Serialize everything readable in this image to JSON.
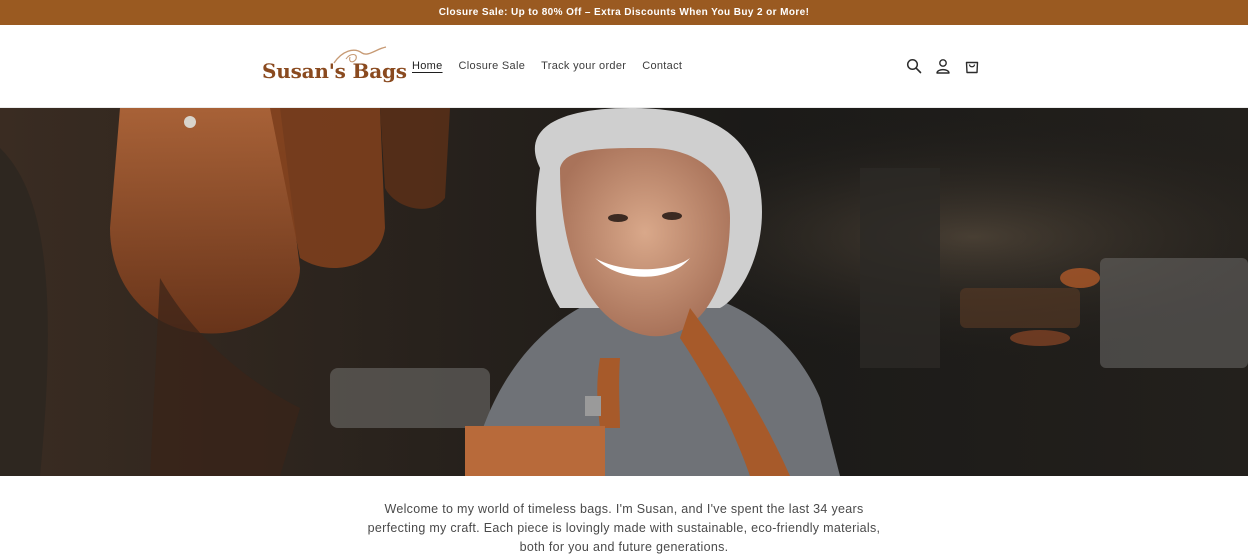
{
  "announcement": {
    "text": "Closure Sale: Up to 80% Off – Extra Discounts When You Buy 2 or More!"
  },
  "brand": {
    "logo_text": "Susan's Bags",
    "accent": "#9a5a21",
    "logo_color": "#8a4a1f"
  },
  "nav": {
    "items": [
      {
        "label": "Home",
        "active": true
      },
      {
        "label": "Closure Sale",
        "active": false
      },
      {
        "label": "Track your order",
        "active": false
      },
      {
        "label": "Contact",
        "active": false
      }
    ]
  },
  "header_icons": [
    "search-icon",
    "account-icon",
    "cart-icon"
  ],
  "hero": {
    "description": "Photo of a smiling older woman with silver hair wearing a brown leather apron in a workshop with hanging leather bags"
  },
  "intro": {
    "text": "Welcome to my world of timeless bags. I'm Susan, and I've spent the last 34 years perfecting my craft. Each piece is lovingly made with sustainable, eco-friendly materials, both for you and future generations."
  }
}
